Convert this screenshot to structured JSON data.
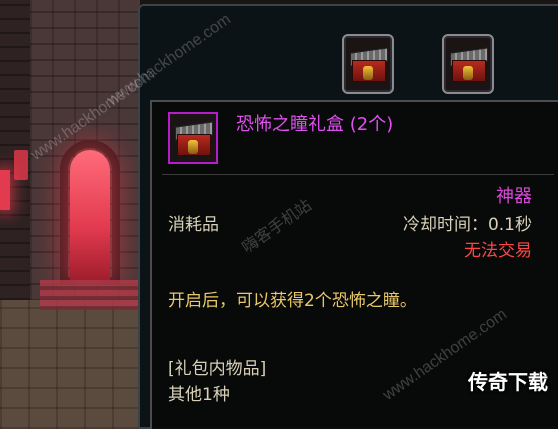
{
  "tooltip": {
    "title": "恐怖之瞳礼盒 (2个)",
    "rarity": "神器",
    "item_type": "消耗品",
    "cooldown": "冷却时间：0.1秒",
    "trade": "无法交易",
    "description": "开启后，可以获得2个恐怖之瞳。",
    "contents_label": "[礼包内物品]",
    "contents_value": "其他1种",
    "icon": "treasure-chest-icon"
  },
  "inventory": {
    "slots": [
      {
        "icon": "treasure-chest-icon"
      },
      {
        "icon": "treasure-chest-icon"
      }
    ]
  },
  "watermarks": {
    "site_1": "www.hackhome.com",
    "site_2": "www.hackhome.com",
    "site_3": "www.hackhome.com",
    "site_cn": "嗨客手机站",
    "badge": "传奇下载"
  },
  "colors": {
    "title": "#e04ff0",
    "rarity": "#d84ad8",
    "trade": "#ff4646",
    "description": "#e8c86a",
    "text": "#d8d0b8",
    "icon_border": "#b41ec8"
  }
}
